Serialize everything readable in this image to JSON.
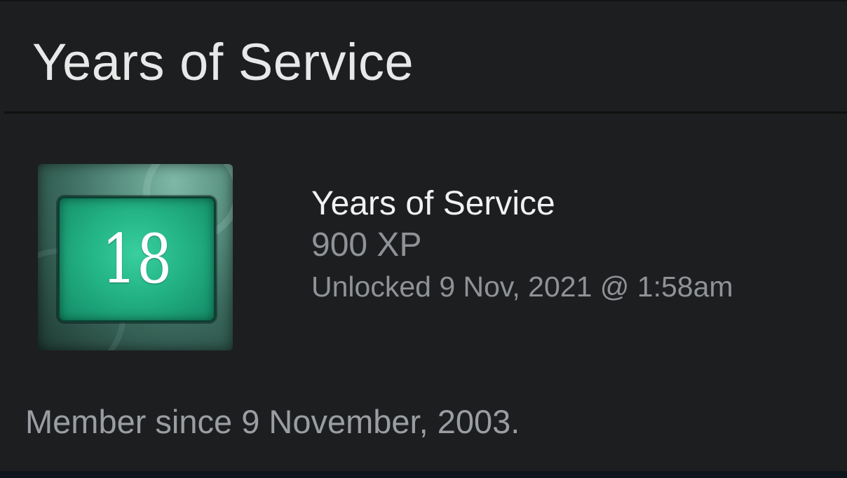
{
  "panel": {
    "title": "Years of Service"
  },
  "badge": {
    "icon_name": "years-of-service-badge-icon",
    "number": "18",
    "name": "Years of Service",
    "xp": "900 XP",
    "unlocked": "Unlocked 9 Nov, 2021 @ 1:58am",
    "screen_color": "#23b384"
  },
  "footer": {
    "member_since": "Member since 9 November, 2003."
  }
}
